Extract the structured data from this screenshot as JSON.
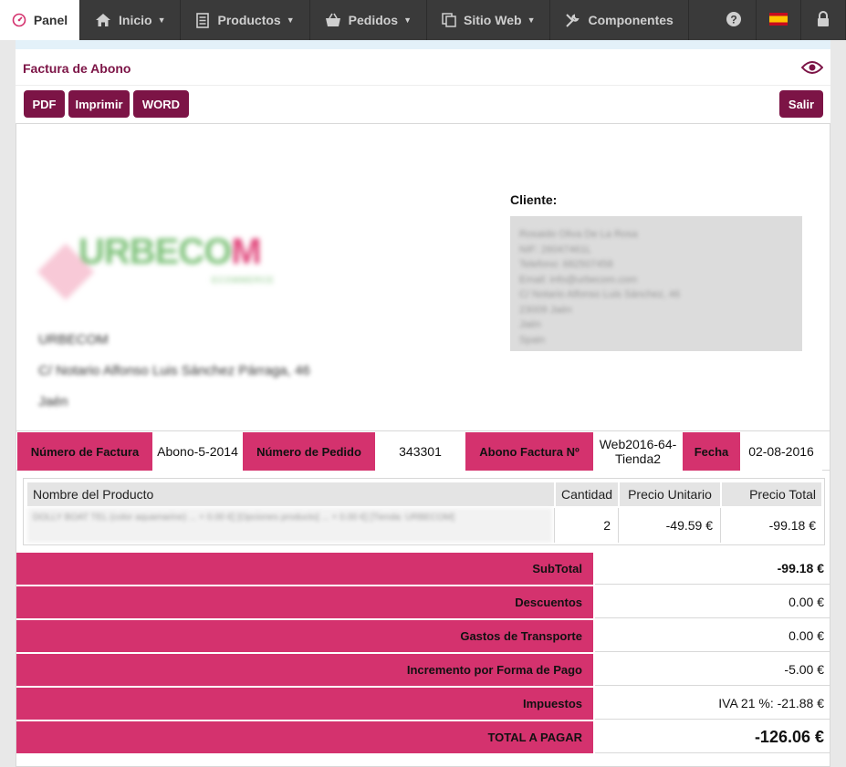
{
  "nav": {
    "panel": "Panel",
    "inicio": "Inicio",
    "productos": "Productos",
    "pedidos": "Pedidos",
    "sitio_web": "Sitio Web",
    "componentes": "Componentes"
  },
  "colors": {
    "accent": "#7c1446",
    "highlight": "#d4326e",
    "topbar": "#3a3a3a"
  },
  "page": {
    "title": "Factura de Abono"
  },
  "toolbar": {
    "pdf": "PDF",
    "print": "Imprimir",
    "word": "WORD",
    "exit": "Salir"
  },
  "shop": {
    "logo_text_green": "URBECO",
    "logo_text_pink": "M",
    "logo_sub": "ECOMMERCE",
    "name": "URBECOM",
    "address": "C/ Notario Alfonso Luis Sánchez Párraga, 46",
    "city": "Jaén"
  },
  "client": {
    "label": "Cliente:",
    "lines": [
      "Rosaido Oliva De La Rosa",
      "NIF: 26047461L",
      "Telefono: 682507458",
      "Email: info@urbecom.com",
      "C/ Notario Alfonso Luis Sánchez, 46",
      "23009 Jaén",
      "Jaén",
      "Spain"
    ]
  },
  "info": {
    "invoice_number_label": "Número de Factura",
    "invoice_number_value": "Abono-5-2014",
    "order_number_label": "Número de Pedido",
    "order_number_value": "343301",
    "credit_invoice_label": "Abono Factura Nº",
    "credit_invoice_value": "Web2016-64-Tienda2",
    "date_label": "Fecha",
    "date_value": "02-08-2016"
  },
  "products": {
    "headers": {
      "name": "Nombre del Producto",
      "qty": "Cantidad",
      "unit_price": "Precio Unitario",
      "total_price": "Precio Total"
    },
    "rows": [
      {
        "name": "DOLLY BOAT TEL (color aquamarine) ... + 0.00 €] [Opciones producto] ... + 0.00 €] [Tienda: URBECOM]",
        "qty": "2",
        "unit_price": "-49.59 €",
        "total_price": "-99.18 €"
      }
    ]
  },
  "totals": {
    "subtotal_label": "SubTotal",
    "subtotal_value": "-99.18 €",
    "discounts_label": "Descuentos",
    "discounts_value": "0.00 €",
    "shipping_label": "Gastos de Transporte",
    "shipping_value": "0.00 €",
    "payment_fee_label": "Incremento por Forma de Pago",
    "payment_fee_value": "-5.00 €",
    "taxes_label": "Impuestos",
    "taxes_value": "IVA 21 %: -21.88 €",
    "total_label": "TOTAL A PAGAR",
    "total_value": "-126.06 €"
  }
}
